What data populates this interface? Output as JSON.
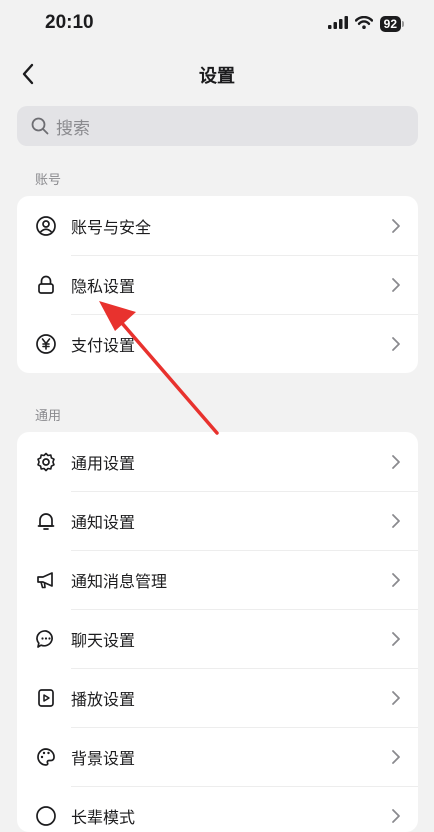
{
  "status": {
    "time": "20:10",
    "battery": "92"
  },
  "nav": {
    "title": "设置"
  },
  "search": {
    "placeholder": "搜索"
  },
  "sections": {
    "account": {
      "header": "账号",
      "items": [
        {
          "label": "账号与安全",
          "icon": "person-circle-icon"
        },
        {
          "label": "隐私设置",
          "icon": "lock-icon"
        },
        {
          "label": "支付设置",
          "icon": "yen-icon"
        }
      ]
    },
    "general": {
      "header": "通用",
      "items": [
        {
          "label": "通用设置",
          "icon": "gear-icon"
        },
        {
          "label": "通知设置",
          "icon": "bell-icon"
        },
        {
          "label": "通知消息管理",
          "icon": "megaphone-icon"
        },
        {
          "label": "聊天设置",
          "icon": "chat-bubble-icon"
        },
        {
          "label": "播放设置",
          "icon": "play-icon"
        },
        {
          "label": "背景设置",
          "icon": "palette-icon"
        },
        {
          "label": "长辈模式",
          "icon": "elder-mode-icon"
        }
      ]
    }
  },
  "annotation": {
    "color": "#e8322e"
  }
}
